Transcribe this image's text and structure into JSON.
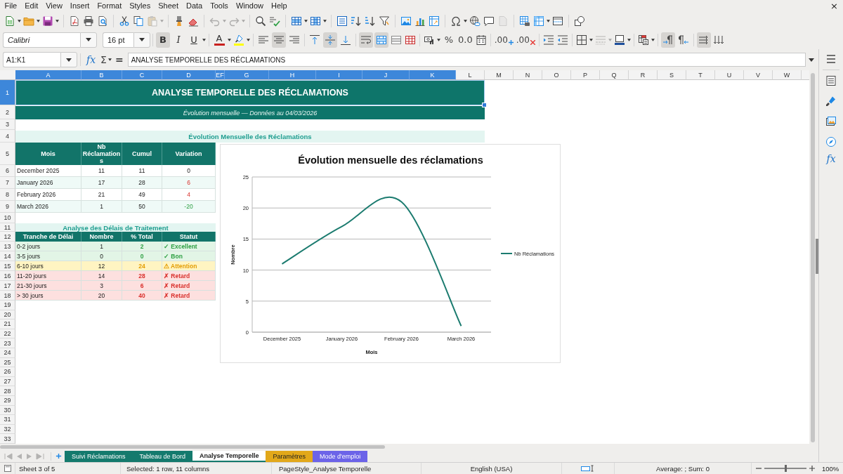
{
  "menu_bar": {
    "items": [
      "File",
      "Edit",
      "View",
      "Insert",
      "Format",
      "Styles",
      "Sheet",
      "Data",
      "Tools",
      "Window",
      "Help"
    ],
    "close": "×"
  },
  "standard_toolbar": {
    "paste_disabled": true,
    "undo_disabled": true,
    "redo_disabled": true,
    "header_footer_disabled": true
  },
  "formatting_toolbar": {
    "font_name": "Calibri",
    "font_size": "16 pt",
    "bold": {
      "label": "B",
      "on": true
    },
    "italic": {
      "label": "I",
      "on": false
    },
    "underline": {
      "label": "U",
      "on": false
    },
    "font_color": {
      "label": "A",
      "color": "#c9211e"
    },
    "highlight": {
      "color": "#ffff00"
    },
    "align_left_on": false,
    "align_center_on": true,
    "align_right_on": false,
    "align_top_on": false,
    "align_middle_on": true,
    "align_bottom_on": false,
    "wrap_text_on": true,
    "merge_center_on": true,
    "percent": "%",
    "number": "0.0",
    "add_decimal": ".00",
    "delete_decimal": ".00",
    "border_style_disabled": true,
    "left_to_right_on": true,
    "right_to_left_on": false,
    "text_direction_on": true
  },
  "formula_bar": {
    "name_box": "A1:K1",
    "function_wizard": "fx",
    "sum": "Σ",
    "equals": "=",
    "content": "ANALYSE TEMPORELLE DES RÉCLAMATIONS"
  },
  "sheet": {
    "column_headers": [
      {
        "label": "A",
        "selected": true
      },
      {
        "label": "B",
        "selected": true
      },
      {
        "label": "C",
        "selected": true
      },
      {
        "label": "D",
        "selected": true
      },
      {
        "label": "EF",
        "selected": true
      },
      {
        "label": "G",
        "selected": true
      },
      {
        "label": "H",
        "selected": true
      },
      {
        "label": "I",
        "selected": true
      },
      {
        "label": "J",
        "selected": true
      },
      {
        "label": "K",
        "selected": true
      },
      {
        "label": "L",
        "selected": false
      },
      {
        "label": "M",
        "selected": false
      },
      {
        "label": "N",
        "selected": false
      },
      {
        "label": "O",
        "selected": false
      },
      {
        "label": "P",
        "selected": false
      },
      {
        "label": "Q",
        "selected": false
      },
      {
        "label": "R",
        "selected": false
      },
      {
        "label": "S",
        "selected": false
      },
      {
        "label": "T",
        "selected": false
      },
      {
        "label": "U",
        "selected": false
      },
      {
        "label": "V",
        "selected": false
      },
      {
        "label": "W",
        "selected": false
      }
    ],
    "row_headers": [
      {
        "label": "1",
        "selected": true
      },
      {
        "label": "2",
        "selected": false
      },
      {
        "label": "3",
        "selected": false
      },
      {
        "label": "4",
        "selected": false
      },
      {
        "label": "5",
        "selected": false
      },
      {
        "label": "6",
        "selected": false
      },
      {
        "label": "7",
        "selected": false
      },
      {
        "label": "8",
        "selected": false
      },
      {
        "label": "9",
        "selected": false
      },
      {
        "label": "10",
        "selected": false
      },
      {
        "label": "11",
        "selected": false
      },
      {
        "label": "12",
        "selected": false
      },
      {
        "label": "13",
        "selected": false
      },
      {
        "label": "14",
        "selected": false
      },
      {
        "label": "15",
        "selected": false
      },
      {
        "label": "16",
        "selected": false
      },
      {
        "label": "17",
        "selected": false
      },
      {
        "label": "18",
        "selected": false
      },
      {
        "label": "19",
        "selected": false
      },
      {
        "label": "20",
        "selected": false
      },
      {
        "label": "21",
        "selected": false
      },
      {
        "label": "22",
        "selected": false
      },
      {
        "label": "23",
        "selected": false
      },
      {
        "label": "24",
        "selected": false
      },
      {
        "label": "25",
        "selected": false
      },
      {
        "label": "26",
        "selected": false
      },
      {
        "label": "27",
        "selected": false
      },
      {
        "label": "28",
        "selected": false
      },
      {
        "label": "29",
        "selected": false
      },
      {
        "label": "30",
        "selected": false
      },
      {
        "label": "31",
        "selected": false
      },
      {
        "label": "32",
        "selected": false
      },
      {
        "label": "33",
        "selected": false
      }
    ],
    "title": {
      "text": "ANALYSE TEMPORELLE DES RÉCLAMATIONS",
      "selected": true
    },
    "subtitle": "Évolution mensuelle — Données au 04/03/2026",
    "monthly_section": {
      "heading": "Évolution Mensuelle des Réclamations",
      "columns": [
        "Mois",
        "Nb Réclamations",
        "Cumul",
        "Variation"
      ],
      "rows": [
        {
          "mois": "December 2025",
          "nb": "11",
          "cumul": "11",
          "variation": {
            "text": "0",
            "kind": "neutral"
          }
        },
        {
          "mois": "January 2026",
          "nb": "17",
          "cumul": "28",
          "variation": {
            "text": "6",
            "kind": "increase"
          }
        },
        {
          "mois": "February 2026",
          "nb": "21",
          "cumul": "49",
          "variation": {
            "text": "4",
            "kind": "increase"
          }
        },
        {
          "mois": "March 2026",
          "nb": "1",
          "cumul": "50",
          "variation": {
            "text": "-20",
            "kind": "decrease"
          }
        }
      ]
    },
    "delay_section": {
      "heading": "Analyse des Délais de Traitement",
      "columns": [
        "Tranche de Délai",
        "Nombre",
        "% Total",
        "Statut"
      ],
      "rows": [
        {
          "tranche": "0-2 jours",
          "nombre": "1",
          "pct": "2",
          "statut": "✓ Excellent",
          "kind": "good"
        },
        {
          "tranche": "3-5 jours",
          "nombre": "0",
          "pct": "0",
          "statut": "✓ Bon",
          "kind": "good"
        },
        {
          "tranche": "6-10 jours",
          "nombre": "12",
          "pct": "24",
          "statut": "⚠ Attention",
          "kind": "warning"
        },
        {
          "tranche": "11-20 jours",
          "nombre": "14",
          "pct": "28",
          "statut": "✗ Retard",
          "kind": "late"
        },
        {
          "tranche": "21-30 jours",
          "nombre": "3",
          "pct": "6",
          "statut": "✗ Retard",
          "kind": "late"
        },
        {
          "tranche": "> 30 jours",
          "nombre": "20",
          "pct": "40",
          "statut": "✗ Retard",
          "kind": "late"
        }
      ]
    },
    "chart": {
      "chart_data": {
        "type": "line",
        "title": "Évolution mensuelle des réclamations",
        "xlabel": "Mois",
        "ylabel": "Nombre",
        "categories": [
          "December 2025",
          "January 2026",
          "February 2026",
          "March 2026"
        ],
        "series": [
          {
            "name": "Nb Réclamations",
            "color": "#1b7b6f",
            "values": [
              11,
              17,
              21,
              1
            ]
          }
        ],
        "ylim": [
          0,
          25
        ],
        "yticks": [
          0,
          5,
          10,
          15,
          20,
          25
        ],
        "grid": true
      }
    }
  },
  "sheet_tabs_bar": {
    "nav_disabled": true,
    "tabs": [
      {
        "label": "Suivi Réclamations",
        "color": "#147a6d",
        "selected": false
      },
      {
        "label": "Tableau de Bord",
        "color": "#147a6d",
        "selected": false
      },
      {
        "label": "Analyse Temporelle",
        "color": "#147a6d",
        "selected": true
      },
      {
        "label": "Paramètres",
        "color": "#e2a81a",
        "selected": false
      },
      {
        "label": "Mode d'emploi",
        "color": "#6c63e8",
        "selected": false
      }
    ]
  },
  "status_bar": {
    "sheet": "Sheet 3 of 5",
    "selection": "Selected: 1 row, 11 columns",
    "page_style": "PageStyle_Analyse Temporelle",
    "language": "English (USA)",
    "summary": "Average: ; Sum: 0",
    "zoom": {
      "level": 0.5,
      "label": "100%"
    }
  },
  "sidebar": {
    "functions": "fx"
  }
}
